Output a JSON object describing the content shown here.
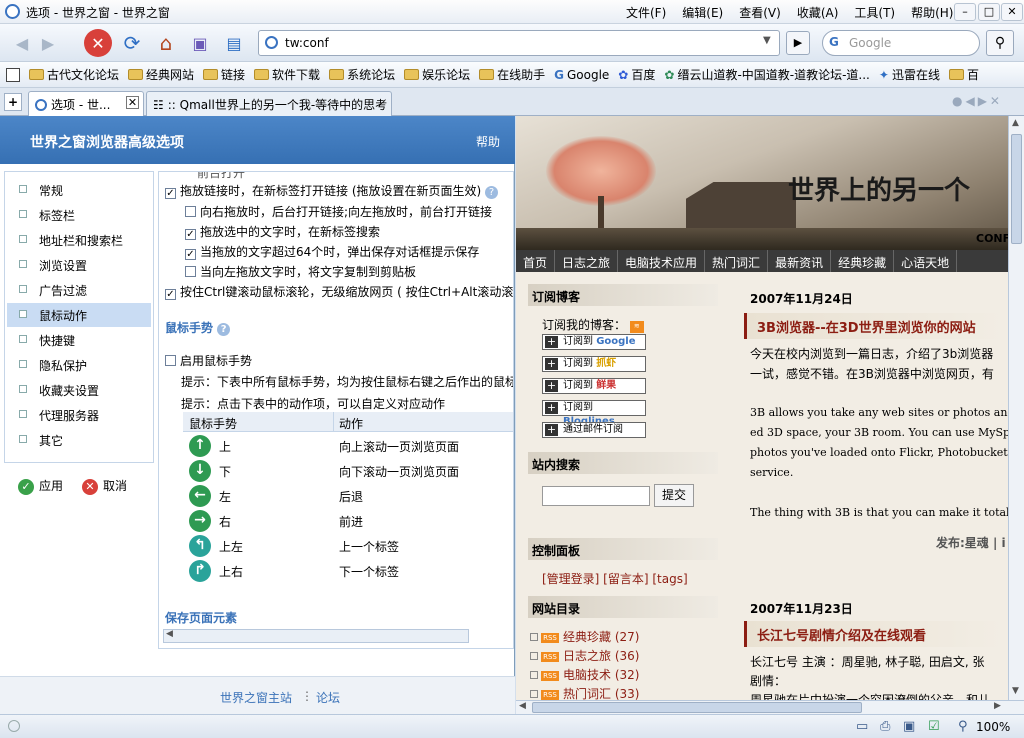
{
  "window": {
    "title": "选项 - 世界之窗 - 世界之窗"
  },
  "menu": [
    "文件(F)",
    "编辑(E)",
    "查看(V)",
    "收藏(A)",
    "工具(T)",
    "帮助(H)"
  ],
  "window_controls": {
    "minimize": "–",
    "maximize": "□",
    "close": "✕"
  },
  "address": {
    "value": "tw:conf"
  },
  "search": {
    "placeholder": "Google"
  },
  "bookmarks": [
    "古代文化论坛",
    "经典网站",
    "链接",
    "软件下载",
    "系统论坛",
    "娱乐论坛",
    "在线助手",
    "Google",
    "百度",
    "缙云山道教-中国道教-道教论坛-道...",
    "迅雷在线",
    "百"
  ],
  "tabs": [
    {
      "label": "选项 - 世..."
    },
    {
      "label": ":: Qmall世界上的另一个我-等待中的思考"
    }
  ],
  "options": {
    "header": "世界之窗浏览器高级选项",
    "help": "帮助",
    "nav": [
      "常规",
      "标签栏",
      "地址栏和搜索栏",
      "浏览设置",
      "广告过滤",
      "鼠标动作",
      "快捷键",
      "隐私保护",
      "收藏夹设置",
      "代理服务器",
      "其它"
    ],
    "selected_nav": "鼠标动作",
    "apply": "应用",
    "cancel": "取消",
    "clipped_top": "前台打开",
    "drag_link": "拖放链接时，在新标签打开链接 (拖放设置在新页面生效)",
    "drag_right": "向右拖放时，后台打开链接;向左拖放时，前台打开链接",
    "drag_text_search": "拖放选中的文字时，在新标签搜索",
    "drag_text_save": "当拖放的文字超过64个时，弹出保存对话框提示保存",
    "drag_left_copy": "当向左拖放文字时，将文字复制到剪贴板",
    "ctrl_wheel": "按住Ctrl键滚动鼠标滚轮，无级缩放网页 ( 按住Ctrl+Alt滚动滚",
    "gesture_section": "鼠标手势",
    "enable_gesture": "启用鼠标手势",
    "hint1": "提示：下表中所有鼠标手势，均为按住鼠标右键之后作出的鼠标",
    "hint2": "提示：点击下表中的动作项，可以自定义对应动作",
    "col_gesture": "鼠标手势",
    "col_action": "动作",
    "gestures": [
      {
        "g": "上",
        "a": "向上滚动一页浏览页面",
        "icon": "↑"
      },
      {
        "g": "下",
        "a": "向下滚动一页浏览页面",
        "icon": "↓"
      },
      {
        "g": "左",
        "a": "后退",
        "icon": "←"
      },
      {
        "g": "右",
        "a": "前进",
        "icon": "→"
      },
      {
        "g": "上左",
        "a": "上一个标签",
        "icon": "↰"
      },
      {
        "g": "上右",
        "a": "下一个标签",
        "icon": "↱"
      }
    ],
    "save_section": "保存页面元素",
    "footer_home": "世界之窗主站",
    "footer_sep": "⋮",
    "footer_forum": "论坛"
  },
  "blog": {
    "banner_title": "世界上的另一个",
    "banner_conf": "CONF",
    "nav": [
      "首页",
      "日志之旅",
      "电脑技术应用",
      "热门词汇",
      "最新资讯",
      "经典珍藏",
      "心语天地"
    ],
    "subscribe_head": "订阅博客",
    "subscribe_label": "订阅我的博客：",
    "sub_buttons": [
      {
        "text": "订阅到",
        "brand": "Google"
      },
      {
        "text": "订阅到",
        "brand": "抓虾"
      },
      {
        "text": "订阅到",
        "brand": "鲜果"
      },
      {
        "text": "订阅到",
        "brand": "Bloglines"
      },
      {
        "text": "通过邮件订阅",
        "brand": ""
      }
    ],
    "search_head": "站内搜索",
    "search_btn": "提交",
    "panel_head": "控制面板",
    "panel_links": "[管理登录] [留言本] [tags]",
    "dir_head": "网站目录",
    "dir": [
      {
        "name": "经典珍藏",
        "count": "(27)"
      },
      {
        "name": "日志之旅",
        "count": "(36)"
      },
      {
        "name": "电脑技术",
        "count": "(32)"
      },
      {
        "name": "热门词汇",
        "count": "(33)"
      }
    ],
    "post1": {
      "date": "2007年11月24日",
      "title": "3B浏览器--在3D世界里浏览你的网站",
      "line1": "今天在校内浏览到一篇日志，介绍了3b浏览器",
      "line2": "一试，感觉不错。在3B浏览器中浏览网页，有",
      "en1": "3B allows you take any web sites or photos and",
      "en2": "ed 3D space, your 3B room. You can use MySpa",
      "en3": "photos you've loaded onto Flickr, Photobucket o",
      "en4": "service.",
      "en5": "The thing with 3B is that you can make it totally",
      "meta": "发布:星魂 | i"
    },
    "post2": {
      "date": "2007年11月23日",
      "title": "长江七号剧情介绍及在线观看",
      "line1": "长江七号  主演 ：周星驰, 林子聪, 田启文, 张",
      "line2": "剧情：",
      "line3": "周星驰在片中扮演一个穷困潦倒的父亲，和儿"
    }
  },
  "status": {
    "zoom": "100%"
  },
  "colors": {
    "header_blue": "#3670b3",
    "link_blue": "#3a72b8",
    "blog_red": "#8c1d12",
    "gesture_green": "#2e9a52"
  }
}
